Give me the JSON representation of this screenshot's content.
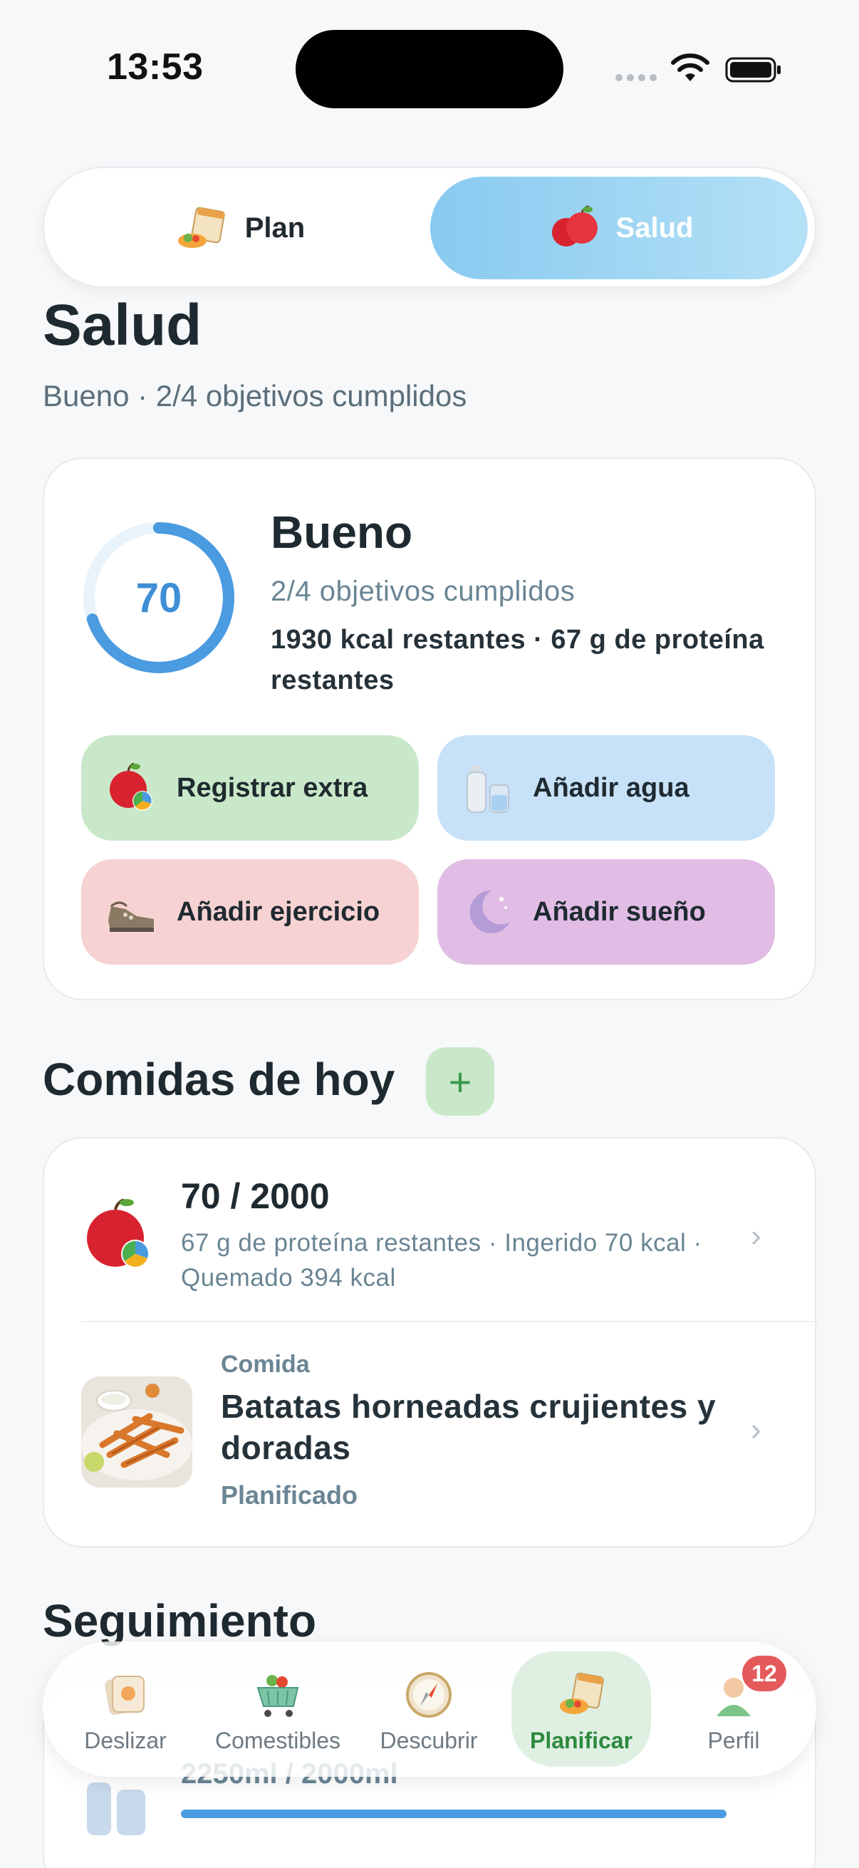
{
  "status_bar": {
    "time": "13:53"
  },
  "segment": {
    "plan_label": "Plan",
    "salud_label": "Salud"
  },
  "header": {
    "title": "Salud",
    "subtitle": "Bueno · 2/4 objetivos cumplidos"
  },
  "summary": {
    "score": "70",
    "score_fraction": 0.7,
    "status": "Bueno",
    "goals": "2/4 objetivos cumplidos",
    "remaining": "1930 kcal restantes · 67 g de proteína restantes",
    "actions": [
      {
        "label": "Registrar extra",
        "icon": "apple-chart-icon"
      },
      {
        "label": "Añadir agua",
        "icon": "water-bottle-icon"
      },
      {
        "label": "Añadir ejercicio",
        "icon": "sneaker-icon"
      },
      {
        "label": "Añadir sueño",
        "icon": "moon-icon"
      }
    ]
  },
  "meals": {
    "title": "Comidas de hoy",
    "add_label": "+",
    "summary_row": {
      "kcal": "70 / 2000",
      "detail": "67 g de proteína restantes · Ingerido 70 kcal · Quemado 394 kcal"
    },
    "meal_row": {
      "type": "Comida",
      "name": "Batatas horneadas crujientes y doradas",
      "state": "Planificado"
    }
  },
  "tracking": {
    "title": "Seguimiento",
    "water_text": "2250ml / 2000ml",
    "water_progress": 1.0
  },
  "nav": {
    "items": [
      {
        "label": "Deslizar",
        "icon": "swipe-cards-icon"
      },
      {
        "label": "Comestibles",
        "icon": "cart-icon"
      },
      {
        "label": "Descubrir",
        "icon": "compass-icon"
      },
      {
        "label": "Planificar",
        "icon": "calendar-icon"
      },
      {
        "label": "Perfil",
        "icon": "person-icon"
      }
    ],
    "profile_badge": "12"
  },
  "colors": {
    "accent_blue": "#4a9be0",
    "green_active": "#2e8a3e",
    "badge_red": "#e45a5a"
  }
}
